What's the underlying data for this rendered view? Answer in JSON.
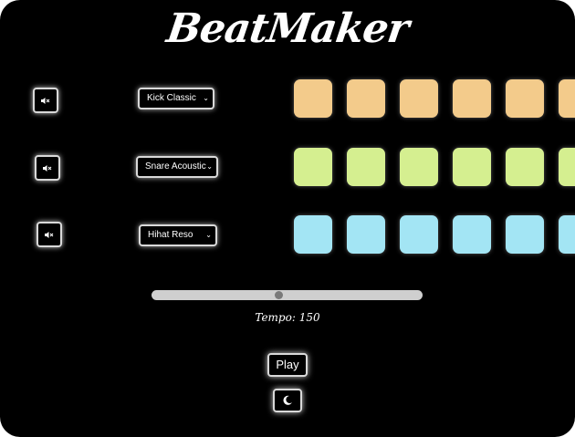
{
  "app": {
    "title": "BeatMaker"
  },
  "tracks": [
    {
      "name": "kick",
      "sound_label": "Kick Classic",
      "pad_color": "#f3cb8b",
      "pads": 6
    },
    {
      "name": "snare",
      "sound_label": "Snare Acoustic",
      "pad_color": "#d5ef90",
      "pads": 6
    },
    {
      "name": "hihat",
      "sound_label": "Hihat Reso",
      "pad_color": "#a3e5f4",
      "pads": 6
    }
  ],
  "tempo": {
    "label": "Tempo: 150",
    "value": 150,
    "slider_fraction": 0.47
  },
  "controls": {
    "play_label": "Play",
    "mute_icon": "speaker-mute-icon",
    "theme_icon": "moon-icon"
  },
  "colors": {
    "background": "#000000",
    "kick": "#f3cb8b",
    "snare": "#d5ef90",
    "hihat": "#a3e5f4"
  }
}
